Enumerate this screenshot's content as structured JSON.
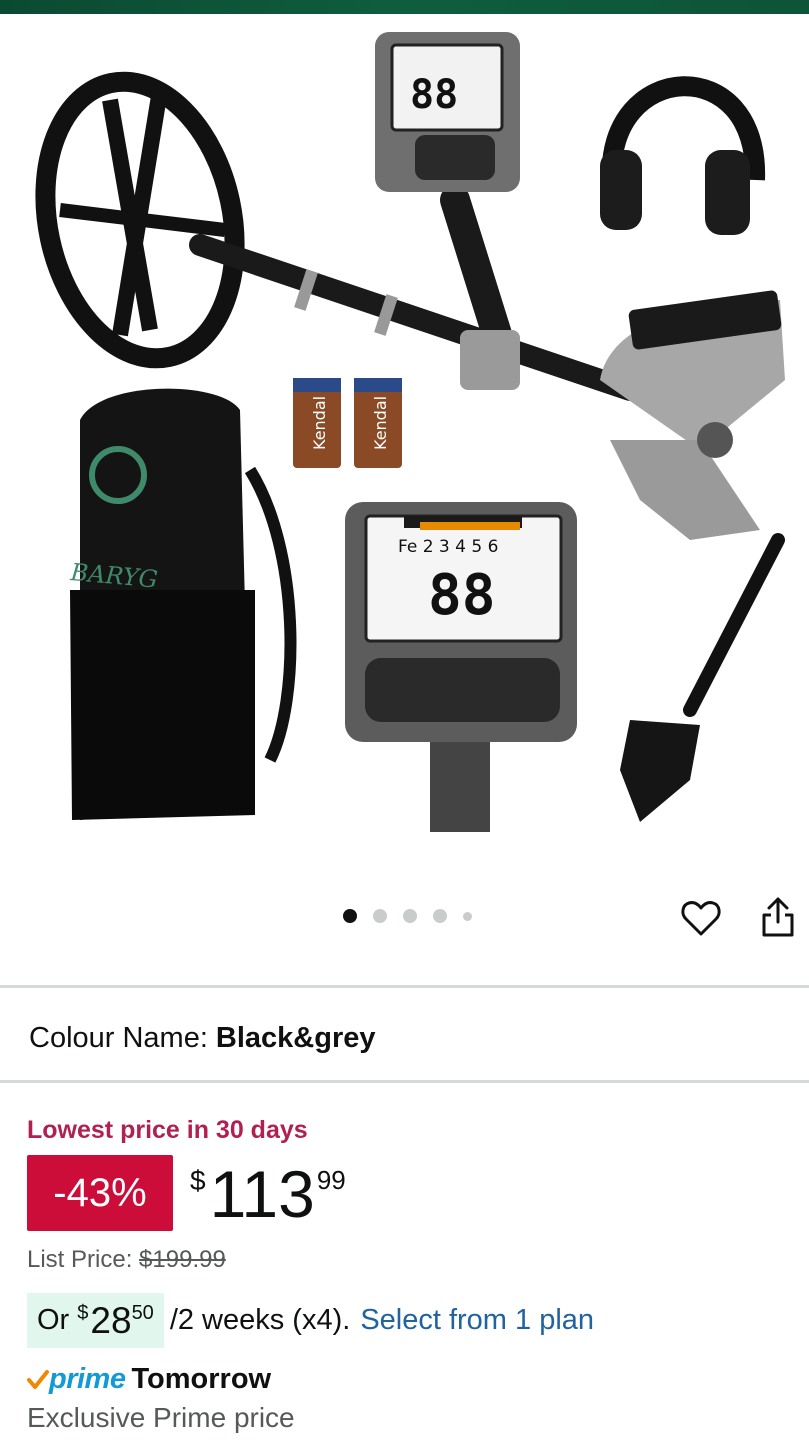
{
  "product": {
    "image_alt": "Metal detector kit with headphones, batteries, backpack, control box and shovel",
    "image_logo_text": "BARYG",
    "battery_brand": "Kendal",
    "display_digits": "88",
    "display_row": "Fe 2 3 4 5 6"
  },
  "carousel": {
    "total": 5,
    "active": 0
  },
  "actions": {
    "wishlist_icon": "heart-icon",
    "share_icon": "share-icon"
  },
  "colour": {
    "label": "Colour Name:",
    "value": "Black&grey"
  },
  "deal": {
    "badge": "Lowest price in 30 days",
    "discount": "-43%"
  },
  "price": {
    "symbol": "$",
    "whole": "113",
    "fraction": "99"
  },
  "list_price": {
    "label": "List Price:",
    "value": "$199.99"
  },
  "installment": {
    "prefix": "Or",
    "symbol": "$",
    "whole": "28",
    "fraction": "50",
    "suffix": "/2 weeks (x4).",
    "link": "Select from 1 plan"
  },
  "delivery": {
    "prime_label": "prime",
    "day": "Tomorrow",
    "note": "Exclusive Prime price"
  },
  "colors": {
    "deal_red": "#cc0c39",
    "deal_text": "#b12150",
    "link_blue": "#2162a1",
    "prime_blue": "#1399d6",
    "plan_bg": "#e1f6ec"
  }
}
